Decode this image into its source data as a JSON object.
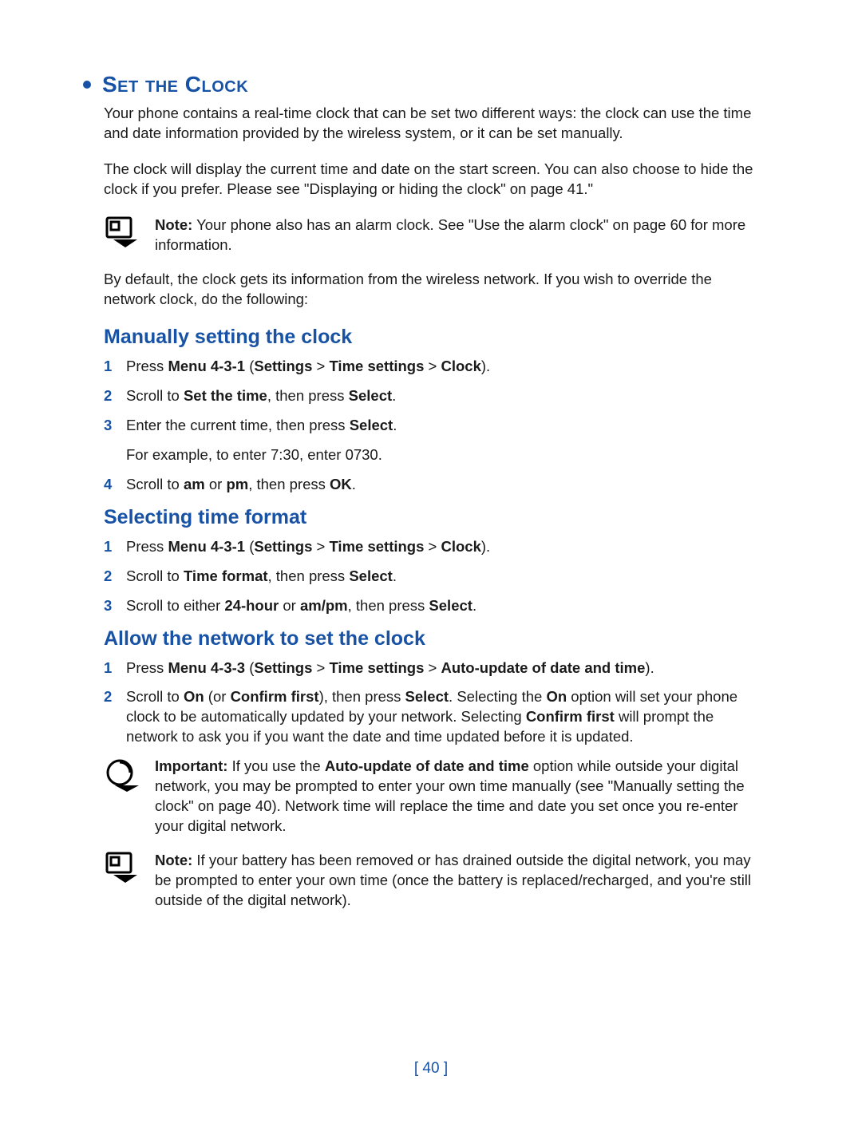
{
  "h1": "Set the Clock",
  "intro1": "Your phone contains a real-time clock that can be set two different ways: the clock can use the time and date information provided by the wireless system, or it can be set manually.",
  "intro2": "The clock will display the current time and date on the start screen. You can also choose to hide the clock if you prefer. Please see \"Displaying or hiding the clock\" on page 41.\"",
  "note1_label": "Note:",
  "note1_body": " Your phone also has an alarm clock. See \"Use the alarm clock\" on page 60 for more information.",
  "intro3": "By default, the clock gets its information from the wireless network. If you wish to override the network clock, do the following:",
  "sec1": {
    "title": "Manually setting the clock",
    "steps": [
      "Press <b>Menu 4-3-1</b> (<b>Settings</b> > <b>Time settings</b> > <b>Clock</b>).",
      "Scroll to <b>Set the time</b>, then press <b>Select</b>.",
      "Enter the current time, then press <b>Select</b>.<span class=\"step-sub\">For example, to enter 7:30, enter 0730.</span>",
      "Scroll to <b>am</b> or <b>pm</b>, then press <b>OK</b>."
    ]
  },
  "sec2": {
    "title": "Selecting time format",
    "steps": [
      "Press <b>Menu 4-3-1</b> (<b>Settings</b> > <b>Time settings</b> > <b>Clock</b>).",
      "Scroll to <b>Time format</b>, then press <b>Select</b>.",
      "Scroll to either <b>24-hour</b> or <b>am/pm</b>, then press <b>Select</b>."
    ]
  },
  "sec3": {
    "title": "Allow the network to set the clock",
    "steps": [
      "Press <b>Menu 4-3-3</b> (<b>Settings</b> > <b>Time settings</b> > <b>Auto-update of date and time</b>).",
      "Scroll to <b>On</b> (or <b>Confirm first</b>), then press <b>Select</b>. Selecting the <b>On</b> option will set your phone clock to be automatically updated by your network. Selecting <b>Confirm first</b> will prompt the network to ask you if you want the date and time updated before it is updated."
    ]
  },
  "important_label": "Important:",
  "important_body": " If you use the <b>Auto-update of date and time</b> option while outside your digital network, you may be prompted to enter your own time manually (see \"Manually setting the clock\" on page 40). Network time will replace the time and date you set once you re-enter your digital network.",
  "note2_label": "Note:",
  "note2_body": " If your battery has been removed or has drained outside the digital network, you may be prompted to enter your own time (once the battery is replaced/recharged, and you're still outside of the digital network).",
  "page_number": "[ 40 ]"
}
